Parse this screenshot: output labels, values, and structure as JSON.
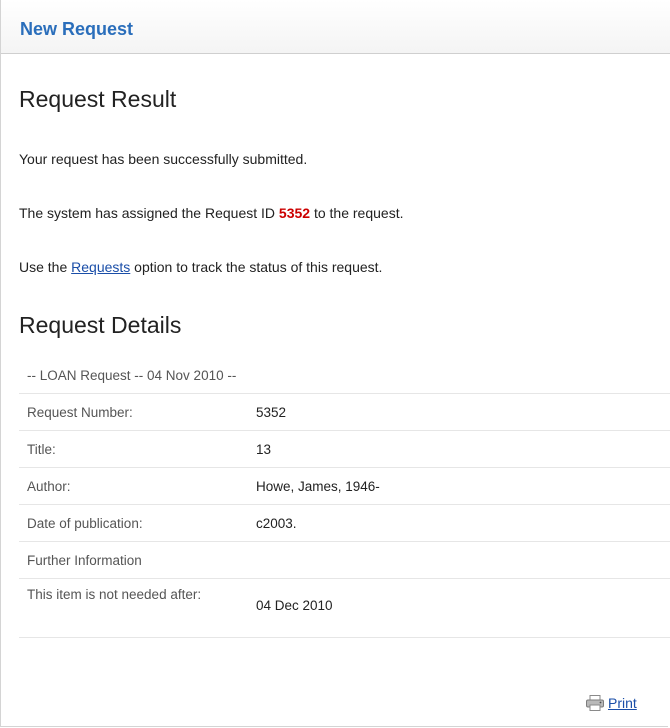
{
  "header": {
    "title": "New Request"
  },
  "result": {
    "heading": "Request Result",
    "line1": "Your request has been successfully submitted.",
    "line2_prefix": "The system has assigned the Request ID ",
    "request_id": "5352",
    "line2_suffix": " to the request.",
    "line3_prefix": "Use the ",
    "requests_link": "Requests",
    "line3_suffix": " option to track the status of this request."
  },
  "details": {
    "heading": "Request Details",
    "caption": "-- LOAN Request -- 04 Nov 2010 --",
    "rows": [
      {
        "label": "Request Number:",
        "value": "5352"
      },
      {
        "label": "Title:",
        "value": "13"
      },
      {
        "label": "Author:",
        "value": "Howe, James, 1946-"
      },
      {
        "label": "Date of publication:",
        "value": "c2003."
      },
      {
        "label": "Further Information",
        "value": ""
      },
      {
        "label": "This item is not needed after:",
        "value": "04 Dec 2010"
      }
    ]
  },
  "footer": {
    "print_label": "Print",
    "icon": "printer-icon"
  }
}
